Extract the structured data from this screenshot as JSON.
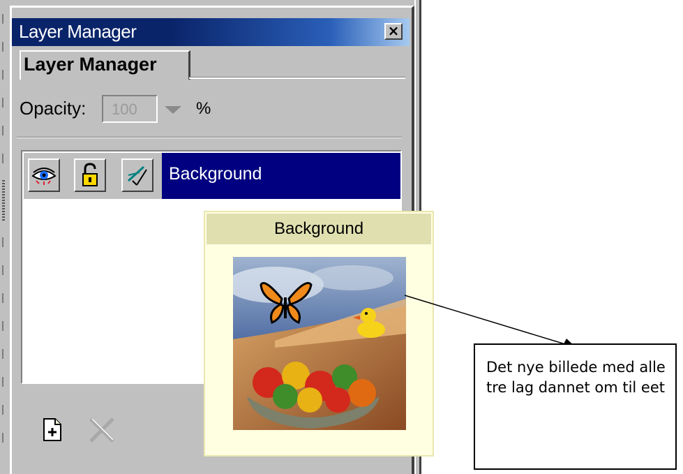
{
  "window": {
    "title": "Layer Manager",
    "close_glyph": "×",
    "close_icon": "close-icon"
  },
  "tabs": [
    {
      "label": "Layer Manager",
      "selected": true
    }
  ],
  "opacity": {
    "label": "Opacity:",
    "value": "100",
    "unit": "%",
    "enabled": false
  },
  "layers": [
    {
      "name": "Background",
      "selected": true,
      "visibility_icon": "eye-icon",
      "lock_icon": "padlock-icon",
      "edit_icon": "brush-icon"
    }
  ],
  "bottom_toolbar": {
    "new_layer_icon": "new-layer-icon",
    "delete_layer_icon": "delete-icon"
  },
  "preview": {
    "title": "Background",
    "image_description_icon": "layer-thumbnail-image"
  },
  "annotation": {
    "text": "Det nye billede med alle tre lag dannet om til eet"
  },
  "colors": {
    "selection": "#000080",
    "titlebar": "#0a246a",
    "tooltip": "#ffffe1",
    "panel": "#c0c0c0"
  }
}
